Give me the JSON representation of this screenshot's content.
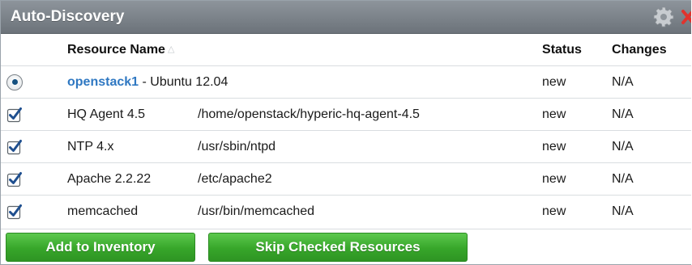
{
  "panel": {
    "title": "Auto-Discovery",
    "icons": [
      "gear-icon",
      "close-icon"
    ]
  },
  "table": {
    "headers": {
      "resource_name": "Resource Name",
      "status": "Status",
      "changes": "Changes"
    },
    "platform": {
      "name": "openstack1",
      "description": " - Ubuntu 12.04",
      "status": "new",
      "changes": "N/A"
    },
    "rows": [
      {
        "name": "HQ Agent 4.5",
        "path": "/home/openstack/hyperic-hq-agent-4.5",
        "status": "new",
        "changes": "N/A"
      },
      {
        "name": "NTP 4.x",
        "path": "/usr/sbin/ntpd",
        "status": "new",
        "changes": "N/A"
      },
      {
        "name": "Apache 2.2.22",
        "path": "/etc/apache2",
        "status": "new",
        "changes": "N/A"
      },
      {
        "name": "memcached",
        "path": "/usr/bin/memcached",
        "status": "new",
        "changes": "N/A"
      }
    ]
  },
  "buttons": {
    "add": "Add to Inventory",
    "skip": "Skip Checked Resources"
  },
  "colors": {
    "titlebar": "#7a8188",
    "link": "#2f78c2",
    "button_green": "#37a62a",
    "close_red": "#e0332d"
  }
}
